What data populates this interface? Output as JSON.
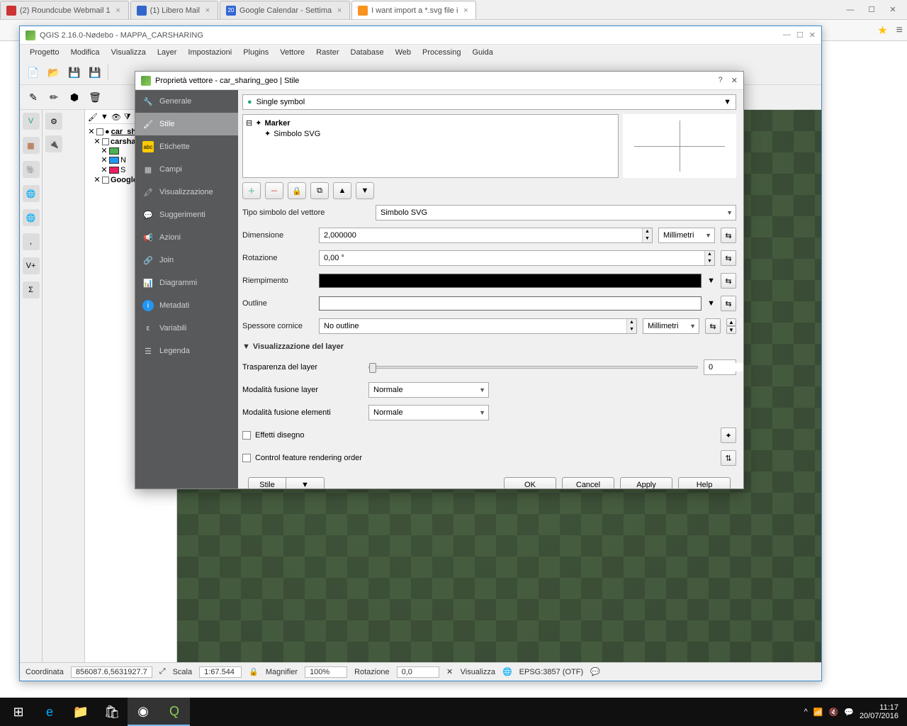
{
  "browser": {
    "tabs": [
      {
        "label": "(2) Roundcube Webmail 1"
      },
      {
        "label": "(1) Libero Mail"
      },
      {
        "label": "Google Calendar - Settima",
        "badge": "20"
      },
      {
        "label": "I want import a *.svg file i",
        "active": true
      }
    ]
  },
  "qgis": {
    "title": "QGIS 2.16.0-Nødebo - MAPPA_CARSHARING",
    "menu": [
      "Progetto",
      "Modifica",
      "Visualizza",
      "Layer",
      "Impostazioni",
      "Plugins",
      "Vettore",
      "Raster",
      "Database",
      "Web",
      "Processing",
      "Guida"
    ],
    "layers": {
      "l1": "car_shari",
      "l2": "carsharin",
      "l3": "N",
      "l4": "S",
      "l5": "Google Satelli"
    },
    "status": {
      "coord_label": "Coordinata",
      "coord": "856087.6,5631927.7",
      "scale_label": "Scala",
      "scale": "1:67.544",
      "mag_label": "Magnifier",
      "mag": "100%",
      "rot_label": "Rotazione",
      "rot": "0,0",
      "render": "Visualizza",
      "crs": "EPSG:3857 (OTF)"
    }
  },
  "dialog": {
    "title": "Proprietà vettore - car_sharing_geo | Stile",
    "help": "?",
    "close": "✕",
    "sidebar": [
      "Generale",
      "Stile",
      "Etichette",
      "Campi",
      "Visualizzazione",
      "Suggerimenti",
      "Azioni",
      "Join",
      "Diagrammi",
      "Metadati",
      "Variabili",
      "Legenda"
    ],
    "sidebar_active": 1,
    "symbol_type": "Single symbol",
    "tree": {
      "root": "Marker",
      "child": "Simbolo SVG"
    },
    "form": {
      "type_label": "Tipo simbolo del vettore",
      "type_value": "Simbolo SVG",
      "dim_label": "Dimensione",
      "dim_value": "2,000000",
      "dim_unit": "Millimetri",
      "rot_label": "Rotazione",
      "rot_value": "0,00 °",
      "fill_label": "Riempimento",
      "outline_label": "Outline",
      "stroke_label": "Spessore cornice",
      "stroke_value": "No outline",
      "stroke_unit": "Millimetri"
    },
    "viz": {
      "header": "Visualizzazione del layer",
      "transp_label": "Trasparenza del layer",
      "transp_value": "0",
      "blend_layer_label": "Modalità fusione layer",
      "blend_layer_value": "Normale",
      "blend_feat_label": "Modalità fusione elementi",
      "blend_feat_value": "Normale",
      "effects": "Effetti disegno",
      "order": "Control feature rendering order"
    },
    "buttons": {
      "style": "Stile",
      "ok": "OK",
      "cancel": "Cancel",
      "apply": "Apply",
      "help": "Help"
    }
  },
  "taskbar": {
    "time": "11:17",
    "date": "20/07/2016"
  }
}
